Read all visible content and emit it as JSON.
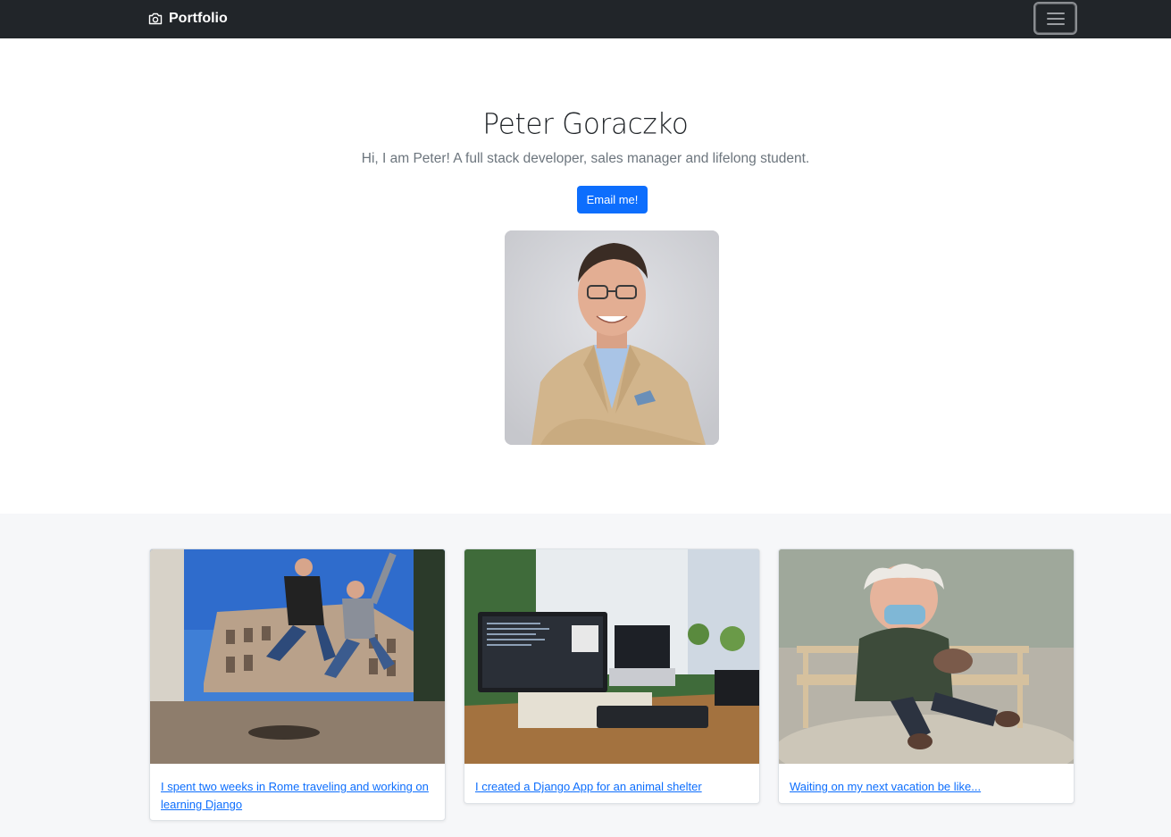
{
  "navbar": {
    "brand_label": "Portfolio",
    "brand_icon": "camera-icon",
    "toggler_icon": "hamburger-icon",
    "background": "#212529"
  },
  "hero": {
    "title": "Peter Goraczko",
    "lead": "Hi, I am Peter! A full stack developer, sales manager and lifelong student.",
    "email_button_label": "Email me!",
    "accent": "#0d6efd"
  },
  "cards": [
    {
      "caption": "I spent two weeks in Rome traveling and working on learning Django"
    },
    {
      "caption": "I created a Django App for an animal shelter"
    },
    {
      "caption": "Waiting on my next vacation be like..."
    }
  ],
  "colors": {
    "link": "#0d6efd",
    "album_background": "#f6f7f9",
    "muted_text": "#6c757d"
  }
}
